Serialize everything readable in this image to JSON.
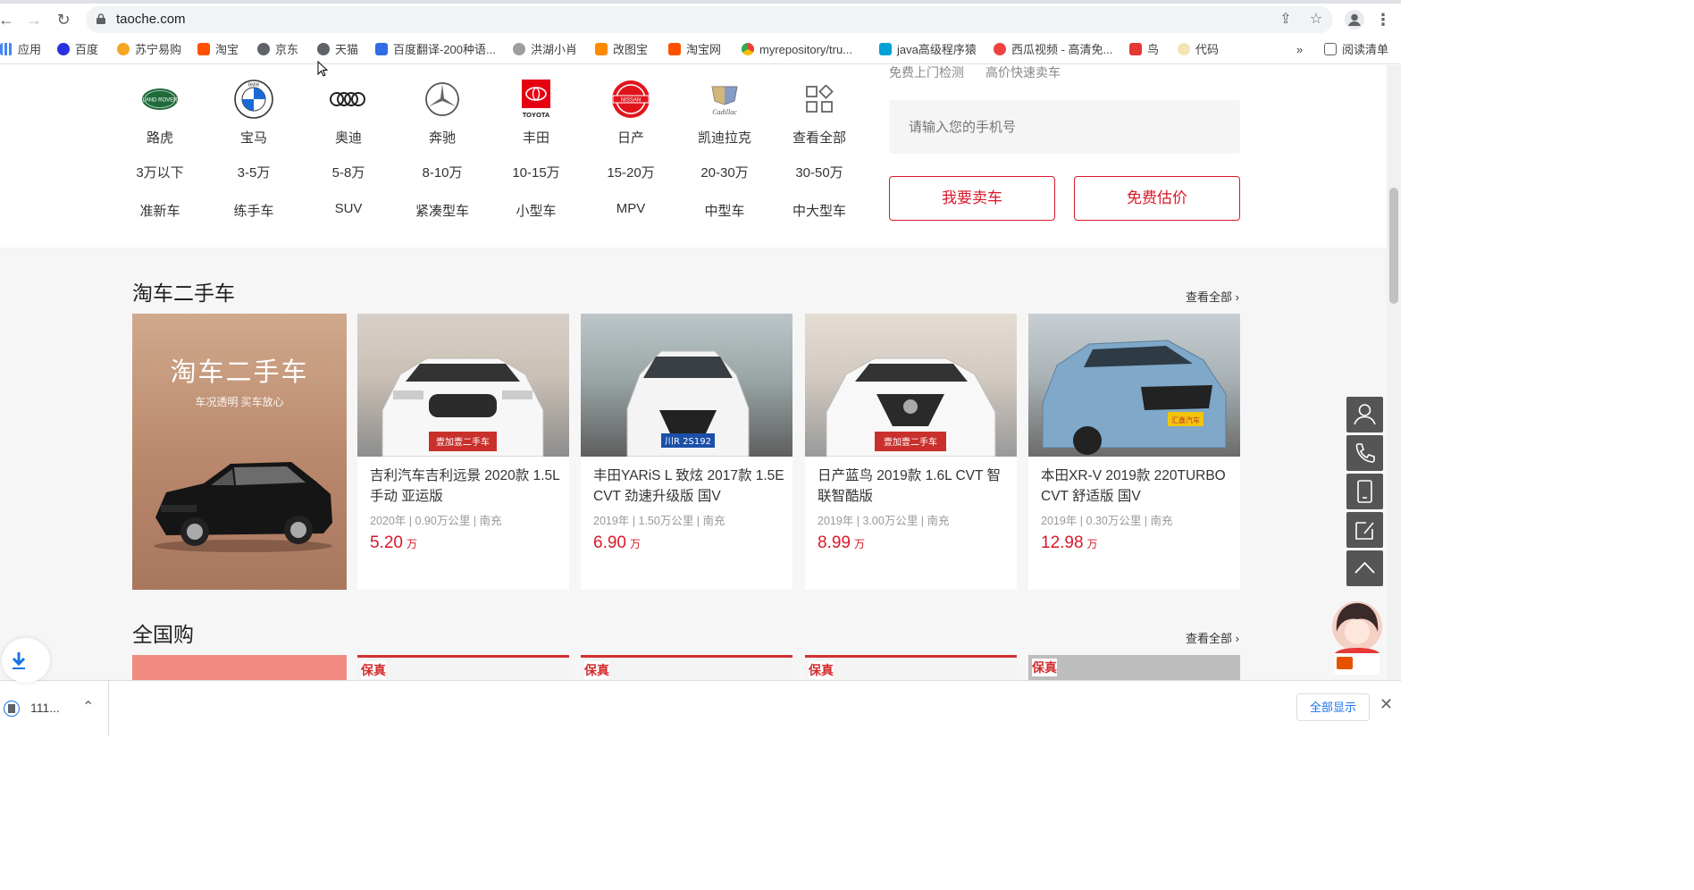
{
  "browser": {
    "url": "taoche.com",
    "bookmarks": [
      "应用",
      "百度",
      "苏宁易购",
      "淘宝",
      "京东",
      "天猫",
      "百度翻译-200种语...",
      "洪湖小肖",
      "改图宝",
      "淘宝网",
      "myrepository/tru...",
      "java高级程序猿",
      "西瓜视频 - 高清免...",
      "鸟",
      "代码"
    ],
    "more_bookmarks": "»",
    "reading_list": "阅读清单"
  },
  "top_cut": [
    "免费上门检测",
    "高价快速卖车"
  ],
  "brands": [
    {
      "name": "路虎",
      "logo": "landrover-icon",
      "text": "LAND ROVER"
    },
    {
      "name": "宝马",
      "logo": "bmw-icon",
      "text": "BMW"
    },
    {
      "name": "奥迪",
      "logo": "audi-icon",
      "text": ""
    },
    {
      "name": "奔驰",
      "logo": "mercedes-icon",
      "text": ""
    },
    {
      "name": "丰田",
      "logo": "toyota-icon",
      "text": "TOYOTA"
    },
    {
      "name": "日产",
      "logo": "nissan-icon",
      "text": "NISSAN"
    },
    {
      "name": "凯迪拉克",
      "logo": "cadillac-icon",
      "text": "Cadillac"
    },
    {
      "name": "查看全部",
      "logo": "grid-icon",
      "text": ""
    }
  ],
  "price_filters": [
    "3万以下",
    "3-5万",
    "5-8万",
    "8-10万",
    "10-15万",
    "15-20万",
    "20-30万",
    "30-50万"
  ],
  "type_filters": [
    "准新车",
    "练手车",
    "SUV",
    "紧凑型车",
    "小型车",
    "MPV",
    "中型车",
    "中大型车"
  ],
  "sell": {
    "phone_placeholder": "请输入您的手机号",
    "sell_button": "我要卖车",
    "estimate_button": "免费估价"
  },
  "used_section": {
    "title": "淘车二手车",
    "view_all": "查看全部",
    "promo_title": "淘车二手车",
    "promo_sub": "车况透明 买车放心",
    "cars": [
      {
        "title": "吉利汽车吉利远景 2020款 1.5L 手动 亚运版",
        "meta": "2020年 | 0.90万公里 | 南充",
        "price": "5.20",
        "unit": "万",
        "plate": "壹加壹二手车"
      },
      {
        "title": "丰田YARiS L 致炫 2017款 1.5E CVT 劲速升级版 国V",
        "meta": "2019年 | 1.50万公里 | 南充",
        "price": "6.90",
        "unit": "万",
        "plate": "川R 2S192"
      },
      {
        "title": "日产蓝鸟 2019款 1.6L CVT 智联智酷版",
        "meta": "2019年 | 3.00万公里 | 南充",
        "price": "8.99",
        "unit": "万",
        "plate": "壹加壹二手车"
      },
      {
        "title": "本田XR-V 2019款 220TURBO CVT 舒适版 国V",
        "meta": "2019年 | 0.30万公里 | 南充",
        "price": "12.98",
        "unit": "万",
        "plate": "汇鑫汽车"
      }
    ]
  },
  "national_section": {
    "title": "全国购",
    "view_all": "查看全部",
    "badge": "保真"
  },
  "downloads": {
    "item": "111...",
    "show_all": "全部显示"
  },
  "colors": {
    "accent": "#d9192b",
    "page_bg": "#f6f6f6"
  }
}
